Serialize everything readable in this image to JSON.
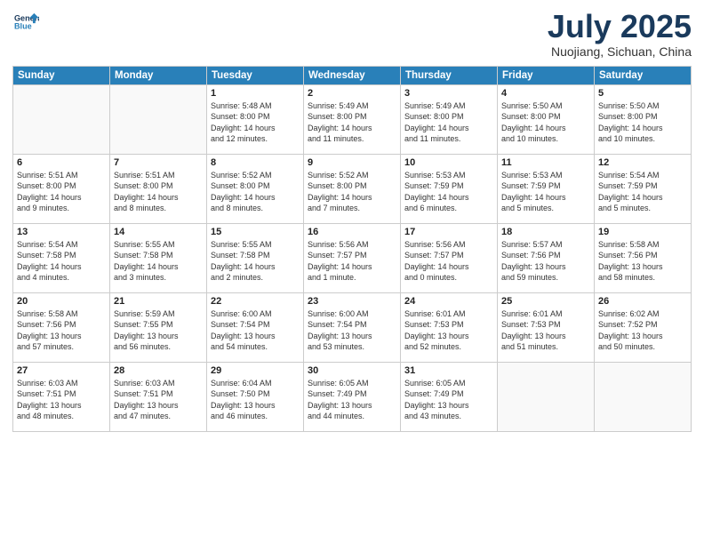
{
  "header": {
    "logo_line1": "General",
    "logo_line2": "Blue",
    "month_title": "July 2025",
    "location": "Nuojiang, Sichuan, China"
  },
  "weekdays": [
    "Sunday",
    "Monday",
    "Tuesday",
    "Wednesday",
    "Thursday",
    "Friday",
    "Saturday"
  ],
  "weeks": [
    [
      {
        "day": "",
        "info": ""
      },
      {
        "day": "",
        "info": ""
      },
      {
        "day": "1",
        "info": "Sunrise: 5:48 AM\nSunset: 8:00 PM\nDaylight: 14 hours\nand 12 minutes."
      },
      {
        "day": "2",
        "info": "Sunrise: 5:49 AM\nSunset: 8:00 PM\nDaylight: 14 hours\nand 11 minutes."
      },
      {
        "day": "3",
        "info": "Sunrise: 5:49 AM\nSunset: 8:00 PM\nDaylight: 14 hours\nand 11 minutes."
      },
      {
        "day": "4",
        "info": "Sunrise: 5:50 AM\nSunset: 8:00 PM\nDaylight: 14 hours\nand 10 minutes."
      },
      {
        "day": "5",
        "info": "Sunrise: 5:50 AM\nSunset: 8:00 PM\nDaylight: 14 hours\nand 10 minutes."
      }
    ],
    [
      {
        "day": "6",
        "info": "Sunrise: 5:51 AM\nSunset: 8:00 PM\nDaylight: 14 hours\nand 9 minutes."
      },
      {
        "day": "7",
        "info": "Sunrise: 5:51 AM\nSunset: 8:00 PM\nDaylight: 14 hours\nand 8 minutes."
      },
      {
        "day": "8",
        "info": "Sunrise: 5:52 AM\nSunset: 8:00 PM\nDaylight: 14 hours\nand 8 minutes."
      },
      {
        "day": "9",
        "info": "Sunrise: 5:52 AM\nSunset: 8:00 PM\nDaylight: 14 hours\nand 7 minutes."
      },
      {
        "day": "10",
        "info": "Sunrise: 5:53 AM\nSunset: 7:59 PM\nDaylight: 14 hours\nand 6 minutes."
      },
      {
        "day": "11",
        "info": "Sunrise: 5:53 AM\nSunset: 7:59 PM\nDaylight: 14 hours\nand 5 minutes."
      },
      {
        "day": "12",
        "info": "Sunrise: 5:54 AM\nSunset: 7:59 PM\nDaylight: 14 hours\nand 5 minutes."
      }
    ],
    [
      {
        "day": "13",
        "info": "Sunrise: 5:54 AM\nSunset: 7:58 PM\nDaylight: 14 hours\nand 4 minutes."
      },
      {
        "day": "14",
        "info": "Sunrise: 5:55 AM\nSunset: 7:58 PM\nDaylight: 14 hours\nand 3 minutes."
      },
      {
        "day": "15",
        "info": "Sunrise: 5:55 AM\nSunset: 7:58 PM\nDaylight: 14 hours\nand 2 minutes."
      },
      {
        "day": "16",
        "info": "Sunrise: 5:56 AM\nSunset: 7:57 PM\nDaylight: 14 hours\nand 1 minute."
      },
      {
        "day": "17",
        "info": "Sunrise: 5:56 AM\nSunset: 7:57 PM\nDaylight: 14 hours\nand 0 minutes."
      },
      {
        "day": "18",
        "info": "Sunrise: 5:57 AM\nSunset: 7:56 PM\nDaylight: 13 hours\nand 59 minutes."
      },
      {
        "day": "19",
        "info": "Sunrise: 5:58 AM\nSunset: 7:56 PM\nDaylight: 13 hours\nand 58 minutes."
      }
    ],
    [
      {
        "day": "20",
        "info": "Sunrise: 5:58 AM\nSunset: 7:56 PM\nDaylight: 13 hours\nand 57 minutes."
      },
      {
        "day": "21",
        "info": "Sunrise: 5:59 AM\nSunset: 7:55 PM\nDaylight: 13 hours\nand 56 minutes."
      },
      {
        "day": "22",
        "info": "Sunrise: 6:00 AM\nSunset: 7:54 PM\nDaylight: 13 hours\nand 54 minutes."
      },
      {
        "day": "23",
        "info": "Sunrise: 6:00 AM\nSunset: 7:54 PM\nDaylight: 13 hours\nand 53 minutes."
      },
      {
        "day": "24",
        "info": "Sunrise: 6:01 AM\nSunset: 7:53 PM\nDaylight: 13 hours\nand 52 minutes."
      },
      {
        "day": "25",
        "info": "Sunrise: 6:01 AM\nSunset: 7:53 PM\nDaylight: 13 hours\nand 51 minutes."
      },
      {
        "day": "26",
        "info": "Sunrise: 6:02 AM\nSunset: 7:52 PM\nDaylight: 13 hours\nand 50 minutes."
      }
    ],
    [
      {
        "day": "27",
        "info": "Sunrise: 6:03 AM\nSunset: 7:51 PM\nDaylight: 13 hours\nand 48 minutes."
      },
      {
        "day": "28",
        "info": "Sunrise: 6:03 AM\nSunset: 7:51 PM\nDaylight: 13 hours\nand 47 minutes."
      },
      {
        "day": "29",
        "info": "Sunrise: 6:04 AM\nSunset: 7:50 PM\nDaylight: 13 hours\nand 46 minutes."
      },
      {
        "day": "30",
        "info": "Sunrise: 6:05 AM\nSunset: 7:49 PM\nDaylight: 13 hours\nand 44 minutes."
      },
      {
        "day": "31",
        "info": "Sunrise: 6:05 AM\nSunset: 7:49 PM\nDaylight: 13 hours\nand 43 minutes."
      },
      {
        "day": "",
        "info": ""
      },
      {
        "day": "",
        "info": ""
      }
    ]
  ]
}
